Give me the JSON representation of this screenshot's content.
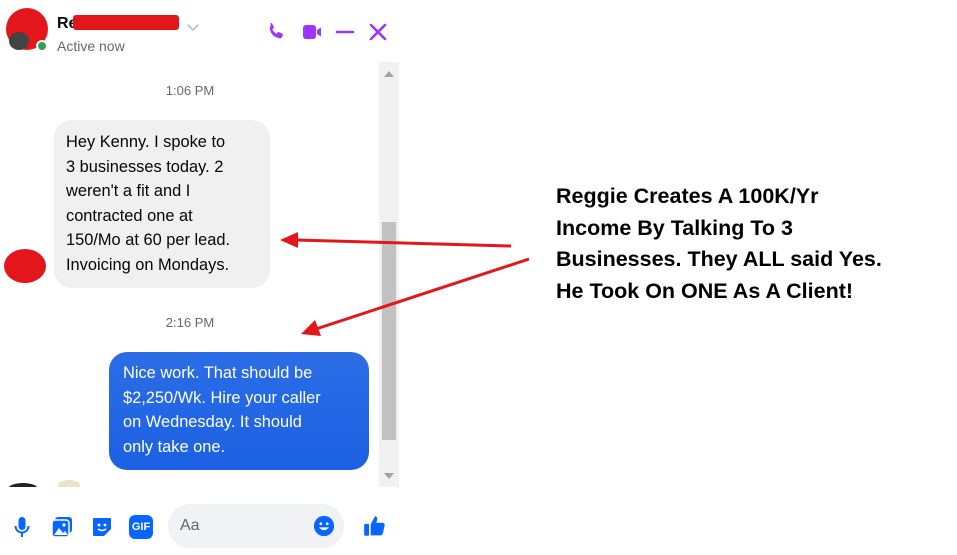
{
  "header": {
    "contact_name": "Re",
    "status": "Active now",
    "icons": [
      "phone-icon",
      "video-icon",
      "minimize-icon",
      "close-icon"
    ],
    "accent_color": "#a033ff"
  },
  "messages": [
    {
      "type": "timestamp",
      "text": "1:06 PM"
    },
    {
      "type": "incoming",
      "lines": [
        "Hey Kenny. I spoke to",
        "3 businesses today. 2",
        "weren't a fit and I",
        "contracted one at",
        "150/Mo at 60 per lead.",
        "Invoicing on Mondays."
      ]
    },
    {
      "type": "timestamp",
      "text": "2:16 PM"
    },
    {
      "type": "outgoing",
      "lines": [
        "Nice work. That should be",
        "$2,250/Wk. Hire your caller",
        "on Wednesday. It should",
        "only take one."
      ]
    }
  ],
  "composer": {
    "placeholder": "Aa",
    "icons": [
      "microphone-icon",
      "image-icon",
      "sticker-icon",
      "gif-icon",
      "emoji-icon",
      "thumbs-up-icon"
    ],
    "gif_label": "GIF"
  },
  "annotation": {
    "lines": [
      "Reggie Creates A 100K/Yr",
      "Income By Talking To 3",
      "Businesses. They ALL said Yes.",
      "He Took On ONE As A Client!"
    ],
    "arrow_color": "#e3161c"
  }
}
